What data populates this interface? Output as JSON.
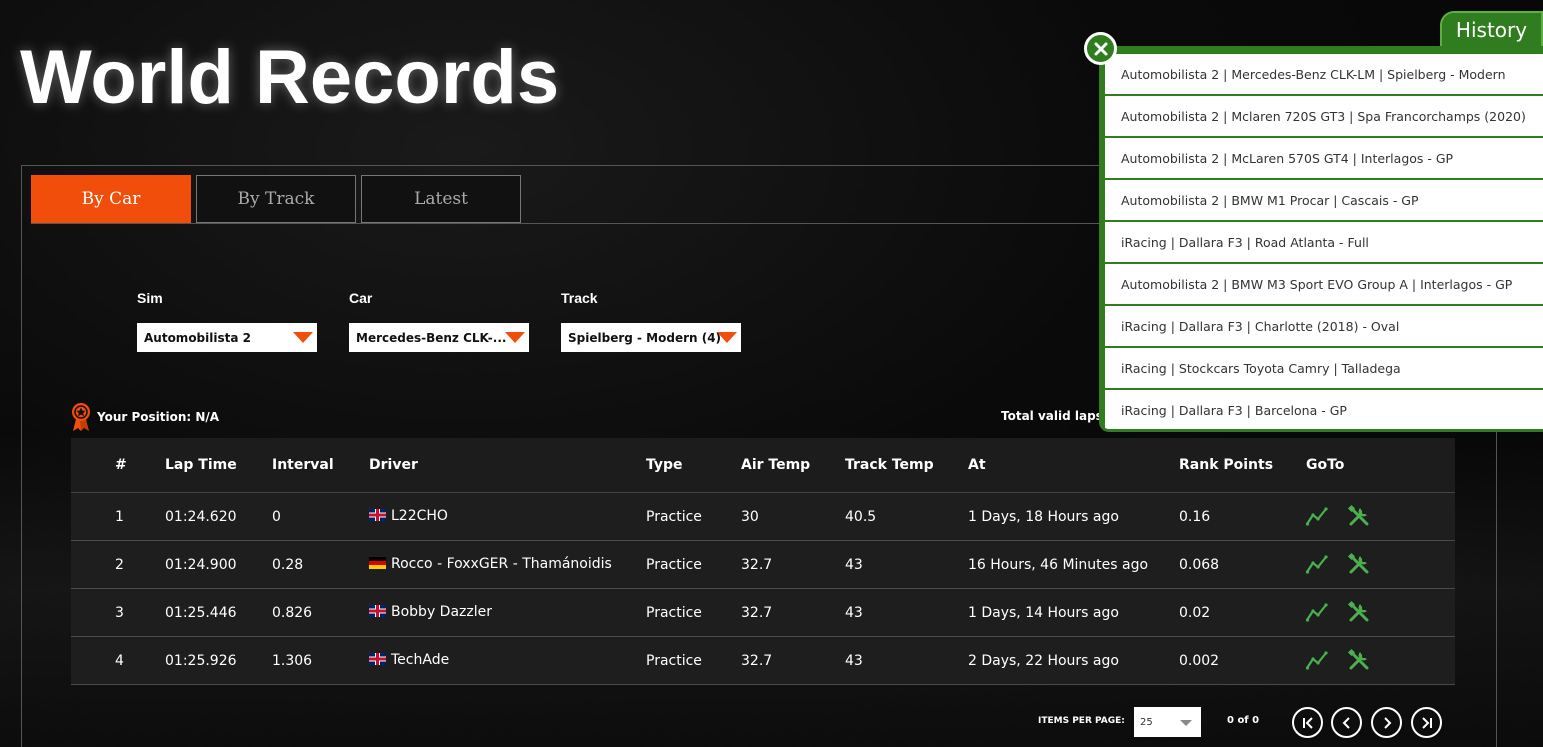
{
  "title": "World Records",
  "tabs": [
    {
      "label": "By Car",
      "active": true
    },
    {
      "label": "By Track",
      "active": false
    },
    {
      "label": "Latest",
      "active": false
    }
  ],
  "filters": {
    "sim": {
      "label": "Sim",
      "value": "Automobilista 2"
    },
    "car": {
      "label": "Car",
      "value": "Mercedes-Benz CLK-..."
    },
    "track": {
      "label": "Track",
      "value": "Spielberg - Modern (4)"
    }
  },
  "position": {
    "label": "Your Position: N/A"
  },
  "total_laps_label": "Total valid laps:",
  "table": {
    "headers": [
      "#",
      "Lap Time",
      "Interval",
      "Driver",
      "Type",
      "Air Temp",
      "Track Temp",
      "At",
      "Rank Points",
      "GoTo"
    ],
    "rows": [
      {
        "rank": "1",
        "lap_time": "01:24.620",
        "interval": "0",
        "flag": "uk",
        "driver": "L22CHO",
        "type": "Practice",
        "air_temp": "30",
        "track_temp": "40.5",
        "at": "1 Days, 18 Hours ago",
        "rank_points": "0.16"
      },
      {
        "rank": "2",
        "lap_time": "01:24.900",
        "interval": "0.28",
        "flag": "de",
        "driver": "Rocco - FoxxGER - Thamánoidis",
        "type": "Practice",
        "air_temp": "32.7",
        "track_temp": "43",
        "at": "16 Hours, 46 Minutes ago",
        "rank_points": "0.068"
      },
      {
        "rank": "3",
        "lap_time": "01:25.446",
        "interval": "0.826",
        "flag": "uk",
        "driver": "Bobby Dazzler",
        "type": "Practice",
        "air_temp": "32.7",
        "track_temp": "43",
        "at": "1 Days, 14 Hours ago",
        "rank_points": "0.02"
      },
      {
        "rank": "4",
        "lap_time": "01:25.926",
        "interval": "1.306",
        "flag": "uk",
        "driver": "TechAde",
        "type": "Practice",
        "air_temp": "32.7",
        "track_temp": "43",
        "at": "2 Days, 22 Hours ago",
        "rank_points": "0.002"
      }
    ]
  },
  "pagination": {
    "items_per_page_label": "ITEMS PER PAGE:",
    "items_per_page": "25",
    "count": "0 of 0"
  },
  "history": {
    "tab_label": "History",
    "items": [
      "Automobilista 2 | Mercedes-Benz CLK-LM | Spielberg - Modern",
      "Automobilista 2 | Mclaren 720S GT3 | Spa Francorchamps (2020)",
      "Automobilista 2 | McLaren 570S GT4 | Interlagos - GP",
      "Automobilista 2 | BMW M1 Procar | Cascais - GP",
      "iRacing | Dallara F3 | Road Atlanta - Full",
      "Automobilista 2 | BMW M3 Sport EVO Group A | Interlagos - GP",
      "iRacing | Dallara F3 | Charlotte (2018) - Oval",
      "iRacing | Stockcars Toyota Camry | Talladega",
      "iRacing | Dallara F3 | Barcelona - GP"
    ]
  },
  "colors": {
    "accent": "#f04e0a",
    "history_green": "#2f7d1e",
    "icon_green": "#4caf50"
  }
}
